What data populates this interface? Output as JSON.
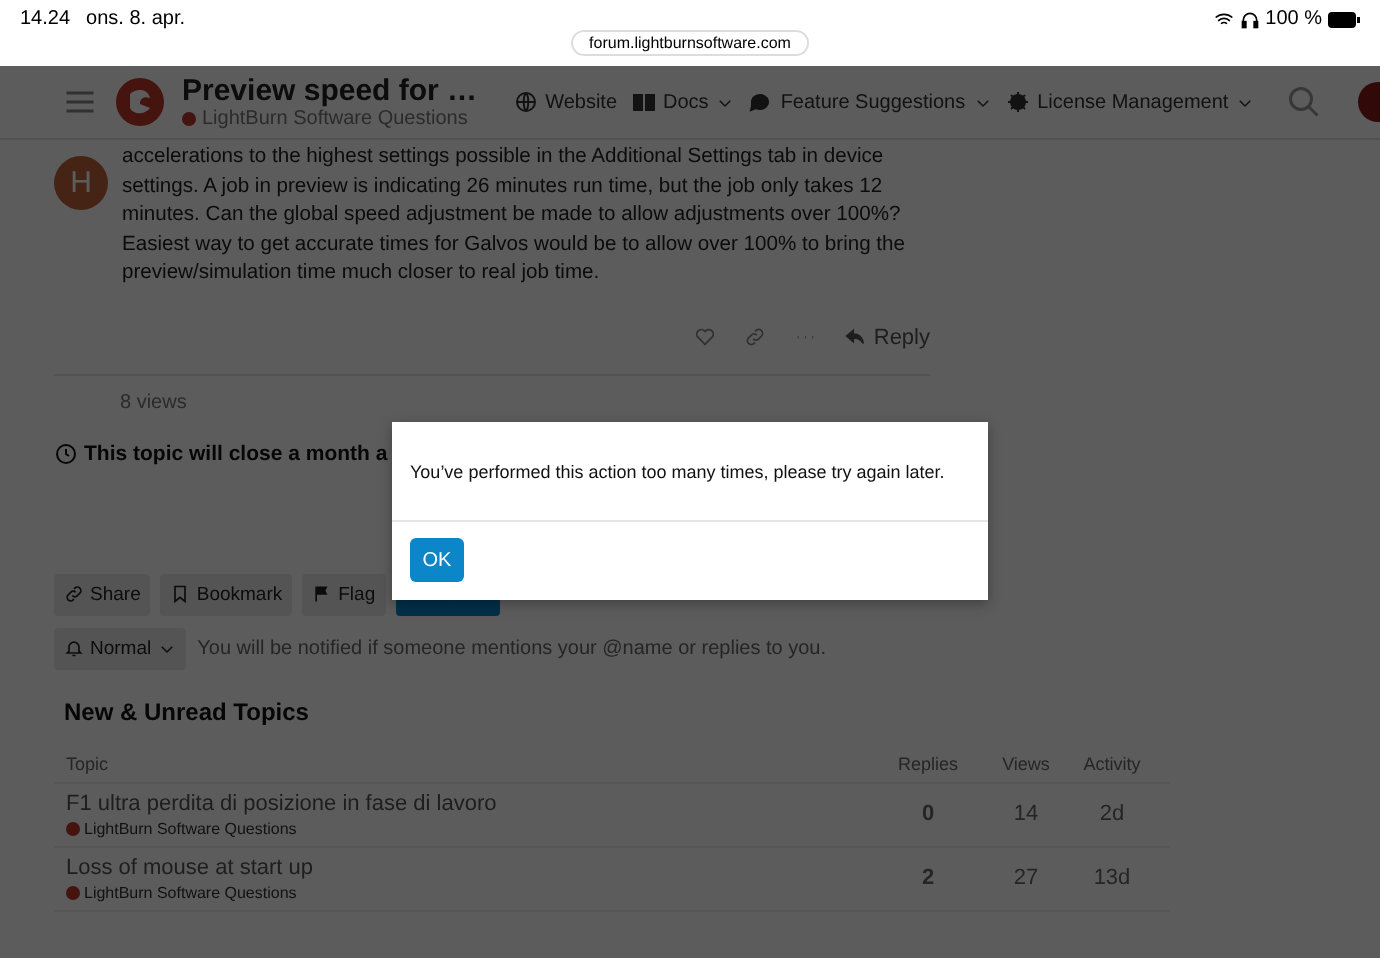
{
  "status_bar": {
    "time": "14.24",
    "date": "ons. 8. apr.",
    "url": "forum.lightburnsoftware.com",
    "battery": "100 %"
  },
  "header": {
    "title": "Preview speed for …",
    "category": "LightBurn Software Questions",
    "nav": [
      {
        "label": "Website",
        "kind": "globe",
        "dropdown": false
      },
      {
        "label": "Docs",
        "kind": "book",
        "dropdown": true
      },
      {
        "label": "Feature Suggestions",
        "kind": "chat",
        "dropdown": true
      },
      {
        "label": "License Management",
        "kind": "gear",
        "dropdown": true
      }
    ]
  },
  "post": {
    "avatar_letter": "H",
    "body": "accelerations to the highest settings possible in the Additional Settings tab in device settings. A job in preview is indicating 26 minutes run time, but the job only takes 12 minutes. Can the global speed adjustment be made to allow adjustments over 100%? Easiest way to get accurate times for Galvos would be to allow over 100% to bring the preview/simulation time much closer to real job time.",
    "reply": "Reply"
  },
  "views": "8 views",
  "close_notice": "This topic will close a month a",
  "topic_buttons": [
    {
      "label": "Share",
      "kind": "link"
    },
    {
      "label": "Bookmark",
      "kind": "bookmark"
    },
    {
      "label": "Flag",
      "kind": "flag"
    },
    {
      "kind": "reply"
    }
  ],
  "notification": {
    "level": "Normal",
    "description": "You will be notified if someone mentions your @name or replies to you."
  },
  "topics": {
    "title": "New & Unread Topics",
    "columns": [
      "Topic",
      "Replies",
      "Views",
      "Activity"
    ],
    "rows": [
      {
        "title": "F1 ultra perdita di posizione in fase di lavoro",
        "category": "LightBurn Software Questions",
        "replies": "0",
        "views": "14",
        "activity": "2d"
      },
      {
        "title": "Loss of mouse at start up",
        "category": "LightBurn Software Questions",
        "replies": "2",
        "views": "27",
        "activity": "13d"
      }
    ]
  },
  "dialog": {
    "message": "You’ve performed this action too many times, please try again later.",
    "button": "OK"
  }
}
